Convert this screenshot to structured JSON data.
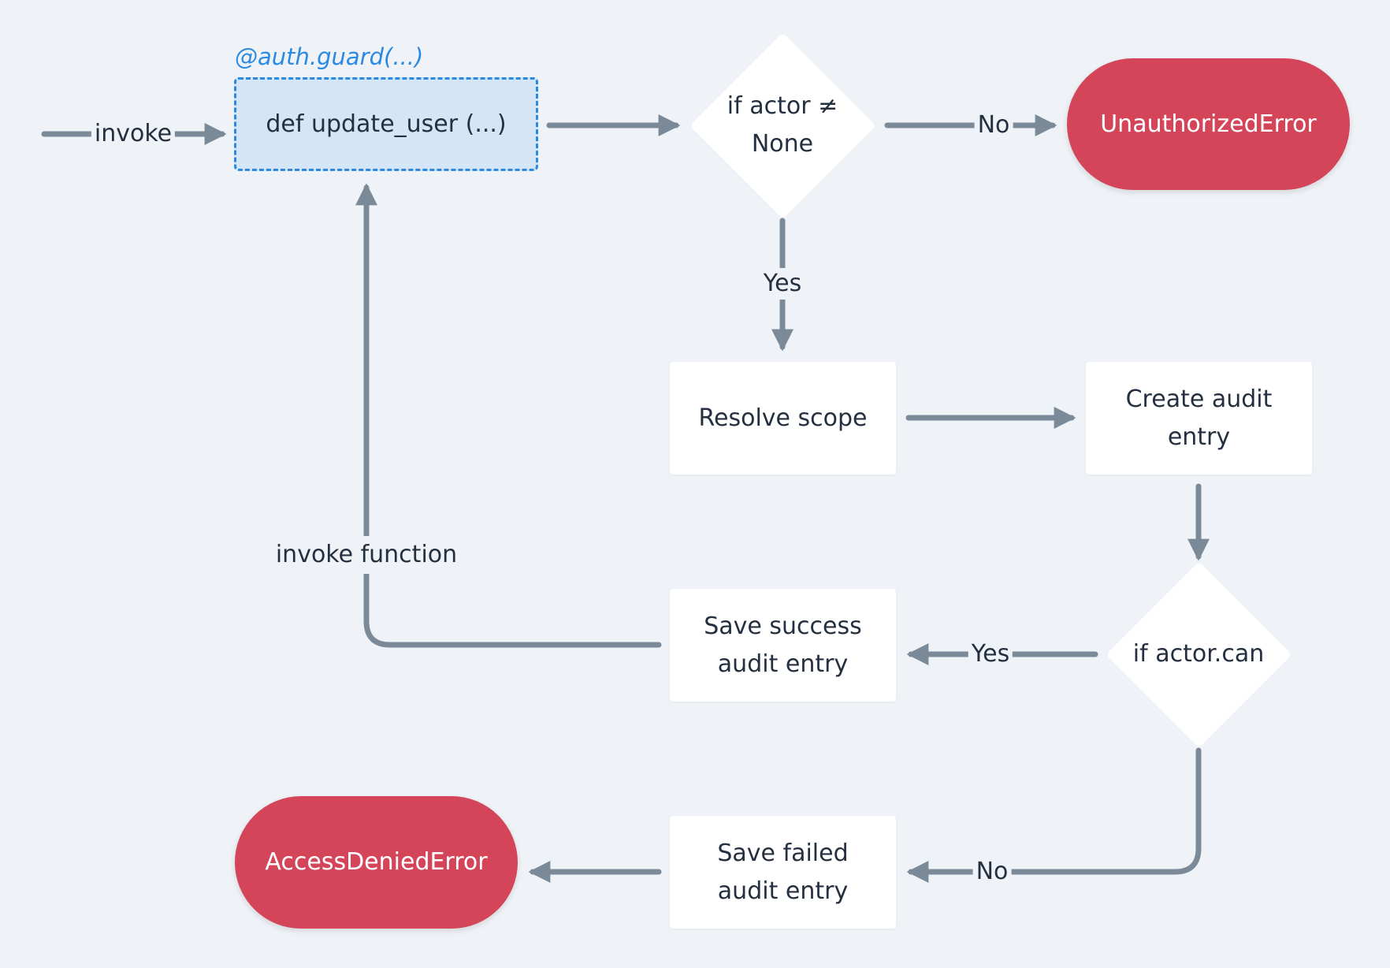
{
  "colors": {
    "background": "#eff3f7",
    "edge": "#7b8a99",
    "error": "#d4455a",
    "accent": "#2b8ae0",
    "function_fill": "#d3e5f7"
  },
  "decorator": "@auth.guard(...)",
  "nodes": {
    "function": "def update_user (...)",
    "check_actor": "if actor ≠ None",
    "unauthorized": "UnauthorizedError",
    "resolve_scope": "Resolve scope",
    "create_audit": "Create audit entry",
    "check_can": "if actor.can",
    "save_success": "Save success audit entry",
    "save_failed": "Save failed audit entry",
    "access_denied": "AccessDeniedError"
  },
  "edge_labels": {
    "invoke": "invoke",
    "no1": "No",
    "yes1": "Yes",
    "yes2": "Yes",
    "no2": "No",
    "invoke_function": "invoke function"
  }
}
